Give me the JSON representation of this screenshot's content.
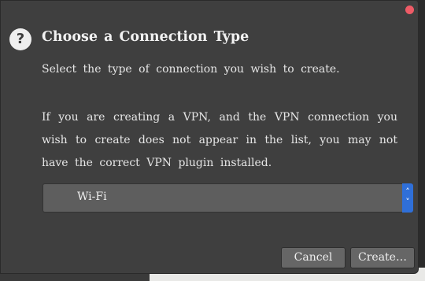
{
  "dialog": {
    "title": "Choose a Connection Type",
    "help_icon_glyph": "?",
    "intro": "Select the type of connection you wish to create.",
    "vpn_note": "If you are creating a VPN, and the VPN connection you wish to create does not appear in the list, you may not have the correct VPN plugin installed.",
    "connection_type": {
      "selected": "Wi-Fi",
      "arrow_up": "˄",
      "arrow_down": "˅"
    },
    "buttons": {
      "cancel": "Cancel",
      "create": "Create…"
    }
  },
  "colors": {
    "dialog_bg": "#3f3f3f",
    "close_button": "#ee5b66",
    "select_bg": "#5e5e5e",
    "select_arrow_bg": "#2f6fd8",
    "button_bg": "#666666",
    "text": "#e6e6e6"
  },
  "icons": {
    "help": "question-circle-icon",
    "close": "close-dot-icon",
    "select_arrows": "up-down-chevron-icon"
  }
}
